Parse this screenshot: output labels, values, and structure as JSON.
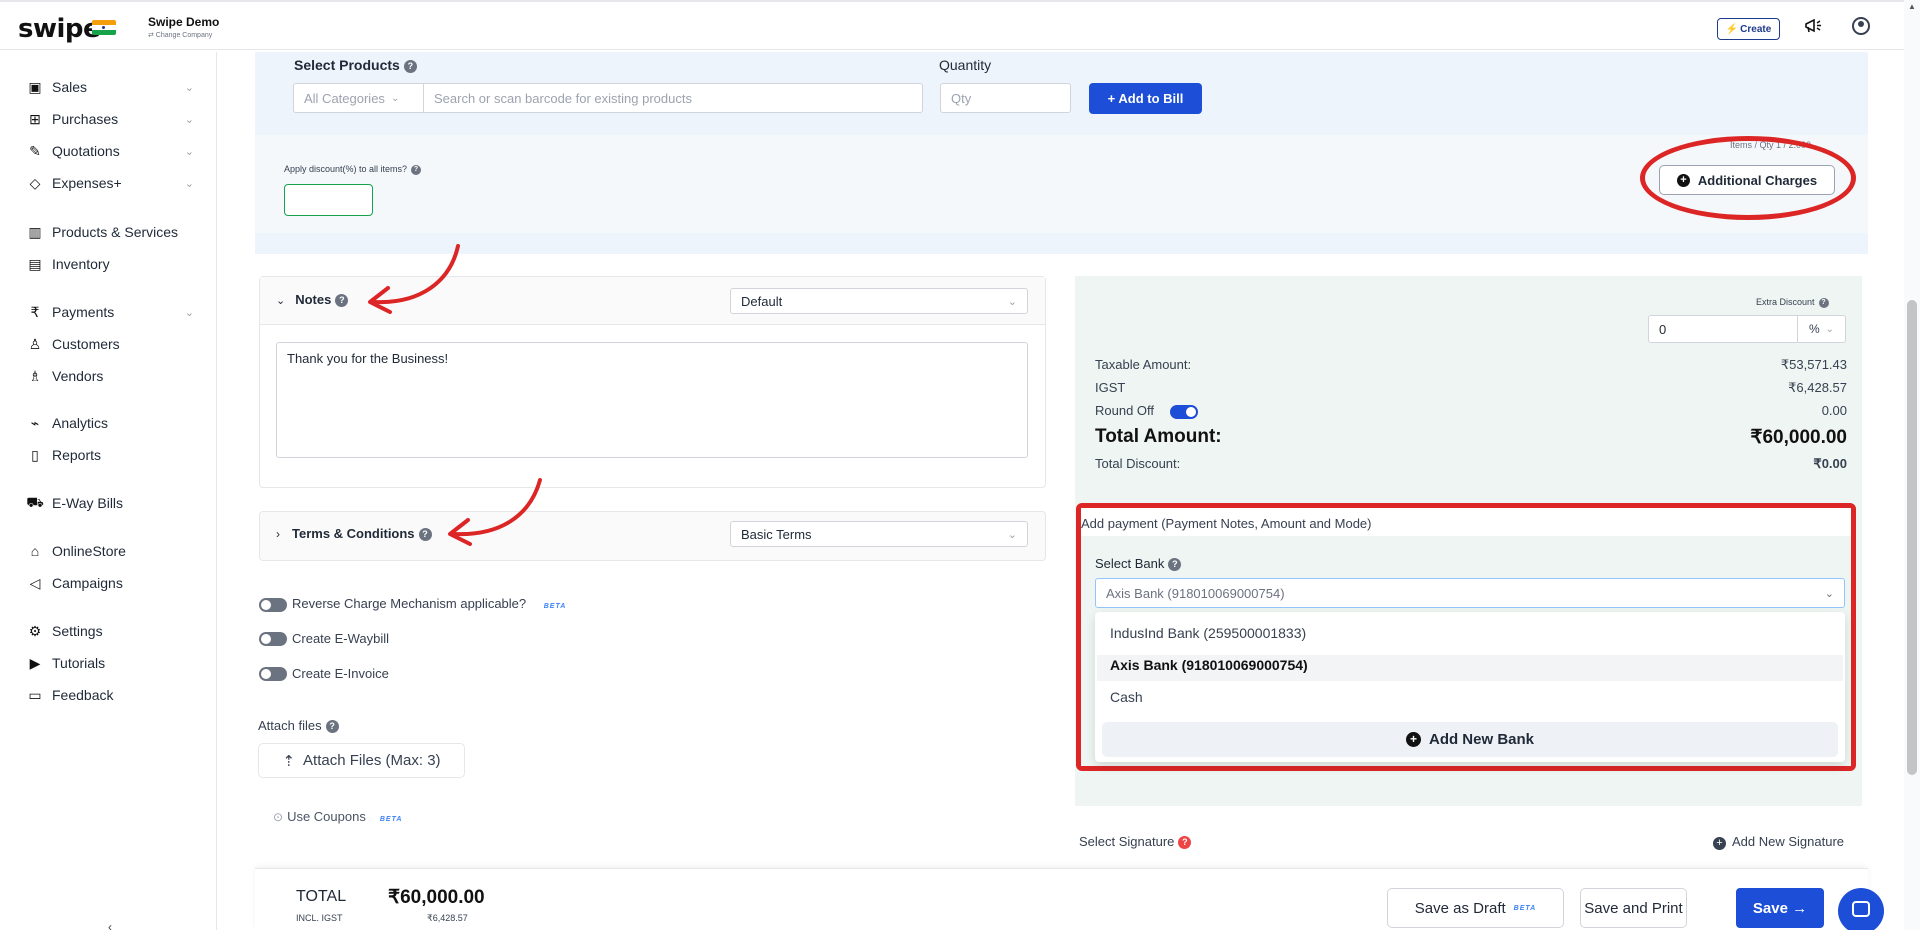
{
  "topbar": {
    "logo": "swipe",
    "company_name": "Swipe Demo",
    "change_company": "⇄ Change Company",
    "create_label": "Create"
  },
  "sidebar": {
    "items": [
      {
        "label": "Sales",
        "icon": "sales-icon",
        "glyph": "▣",
        "chevron": true
      },
      {
        "label": "Purchases",
        "icon": "cart-icon",
        "glyph": "⊞",
        "chevron": true
      },
      {
        "label": "Quotations",
        "icon": "pen-icon",
        "glyph": "✎",
        "chevron": true
      },
      {
        "label": "Expenses+",
        "icon": "tag-icon",
        "glyph": "◇",
        "chevron": true
      },
      {
        "label": "Products & Services",
        "icon": "barcode-icon",
        "glyph": "▥",
        "chevron": false
      },
      {
        "label": "Inventory",
        "icon": "inventory-icon",
        "glyph": "▤",
        "chevron": false
      },
      {
        "label": "Payments",
        "icon": "rupee-icon",
        "glyph": "₹",
        "chevron": true
      },
      {
        "label": "Customers",
        "icon": "user-icon",
        "glyph": "♙",
        "chevron": false
      },
      {
        "label": "Vendors",
        "icon": "users-icon",
        "glyph": "♗",
        "chevron": false
      },
      {
        "label": "Analytics",
        "icon": "chart-icon",
        "glyph": "⌁",
        "chevron": false
      },
      {
        "label": "Reports",
        "icon": "file-icon",
        "glyph": "▯",
        "chevron": false
      },
      {
        "label": "E-Way Bills",
        "icon": "truck-icon",
        "glyph": "⛟",
        "chevron": false
      },
      {
        "label": "OnlineStore",
        "icon": "store-icon",
        "glyph": "⌂",
        "chevron": false
      },
      {
        "label": "Campaigns",
        "icon": "megaphone-icon",
        "glyph": "◁",
        "chevron": false
      },
      {
        "label": "Settings",
        "icon": "gear-icon",
        "glyph": "⚙",
        "chevron": false
      },
      {
        "label": "Tutorials",
        "icon": "video-icon",
        "glyph": "▶",
        "chevron": false
      },
      {
        "label": "Feedback",
        "icon": "chat-icon",
        "glyph": "▭",
        "chevron": false
      }
    ]
  },
  "products": {
    "label": "Select Products",
    "category_placeholder": "All Categories",
    "search_placeholder": "Search or scan barcode for existing products",
    "quantity_label": "Quantity",
    "qty_placeholder": "Qty",
    "add_to_bill": "+ Add to Bill",
    "discount_label": "Apply discount(%) to all items?",
    "items_qty": "Items / Qty 1 / 2.000",
    "additional_charges": "Additional Charges"
  },
  "notes": {
    "label": "Notes",
    "template": "Default",
    "text": "Thank you for the Business!"
  },
  "terms": {
    "label": "Terms & Conditions",
    "template": "Basic Terms"
  },
  "options": {
    "reverse_charge": "Reverse Charge Mechanism applicable?",
    "beta": "BETA",
    "eway": "Create E-Waybill",
    "einvoice": "Create E-Invoice",
    "attach_label": "Attach files",
    "attach_btn": "Attach Files (Max: 3)",
    "coupons": "Use Coupons"
  },
  "summary": {
    "extra_discount_label": "Extra Discount",
    "extra_discount_value": "0",
    "extra_discount_unit": "%",
    "taxable_label": "Taxable Amount:",
    "taxable_value": "₹53,571.43",
    "igst_label": "IGST",
    "igst_value": "₹6,428.57",
    "roundoff_label": "Round Off",
    "roundoff_value": "0.00",
    "total_label": "Total Amount:",
    "total_value": "₹60,000.00",
    "discount_label": "Total Discount:",
    "discount_value": "₹0.00"
  },
  "payment": {
    "heading": "Add payment (Payment Notes, Amount and Mode)",
    "select_bank_label": "Select Bank",
    "selected_bank": "Axis Bank (918010069000754)",
    "options": [
      "IndusInd Bank (259500001833)",
      "Axis Bank (918010069000754)",
      "Cash"
    ],
    "add_new_bank": "Add New Bank"
  },
  "signature": {
    "label": "Select Signature",
    "add_new": "Add New Signature"
  },
  "footer": {
    "total_label": "TOTAL",
    "total_value": "₹60,000.00",
    "incl_label": "INCL. IGST",
    "incl_value": "₹6,428.57",
    "save_draft": "Save as Draft",
    "save_print": "Save and Print",
    "save": "Save →"
  },
  "colors": {
    "accent": "#1d4ed8",
    "annotation": "#dc2626",
    "product_bg": "#eef4fb",
    "summary_bg": "#eef5f2"
  }
}
